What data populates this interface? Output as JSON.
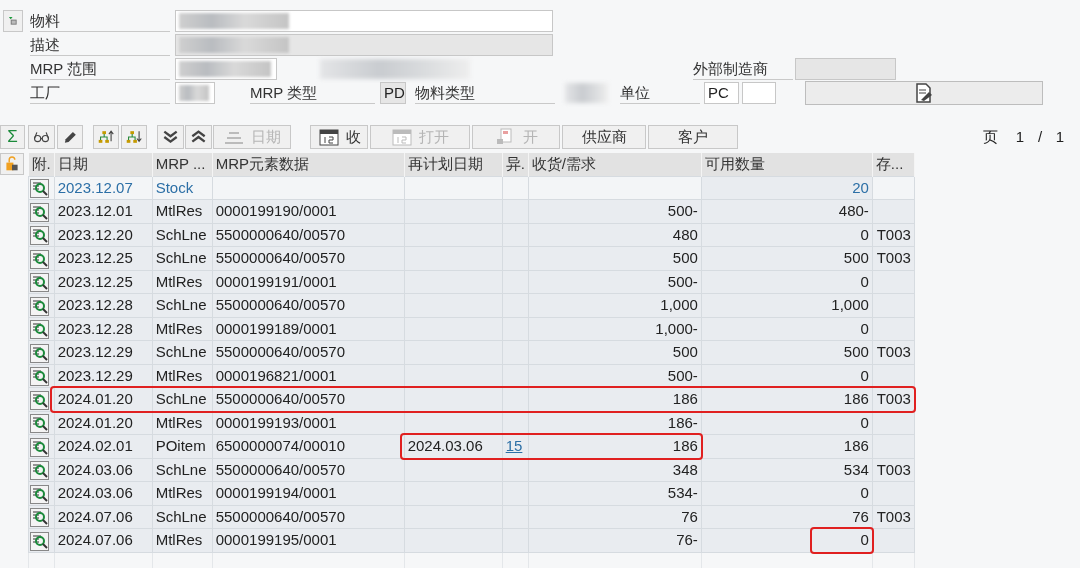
{
  "header_rows": [
    [
      {
        "kind": "filter-button"
      },
      {
        "kind": "label",
        "text": "物料"
      },
      {
        "kind": "field",
        "blurred": true,
        "readonly": false
      }
    ],
    [
      {
        "kind": "label",
        "text": "描述"
      },
      {
        "kind": "field",
        "blurred": true,
        "readonly": true
      }
    ],
    [
      {
        "kind": "label",
        "text": "MRP 范围"
      },
      {
        "kind": "field",
        "blurred": true,
        "readonly": false
      },
      {
        "kind": "blur"
      },
      {
        "kind": "label",
        "text": "外部制造商"
      },
      {
        "kind": "field",
        "readonly": true
      }
    ],
    [
      {
        "kind": "label",
        "text": "工厂"
      },
      {
        "kind": "field",
        "blurred": true,
        "readonly": false
      },
      {
        "kind": "label",
        "text": "MRP 类型"
      },
      {
        "kind": "field",
        "value": "PD",
        "readonly": true
      },
      {
        "kind": "label",
        "text": "物料类型"
      },
      {
        "kind": "blur"
      },
      {
        "kind": "label",
        "text": "单位"
      },
      {
        "kind": "field",
        "value": "PC",
        "readonly": false
      },
      {
        "kind": "field",
        "readonly": false
      },
      {
        "kind": "document-button"
      }
    ]
  ],
  "toolbar": [
    {
      "kind": "sum",
      "label": "Σ",
      "disabled": false
    },
    {
      "kind": "glasses",
      "disabled": false
    },
    {
      "kind": "pencil",
      "disabled": false
    },
    {
      "kind": "tree-up",
      "disabled": false
    },
    {
      "kind": "tree-down",
      "disabled": false
    },
    {
      "kind": "chevrons-down",
      "disabled": false
    },
    {
      "kind": "chevrons-up",
      "disabled": false
    },
    {
      "kind": "lines",
      "label": "日期",
      "disabled": true
    },
    {
      "kind": "calendar",
      "label": "收",
      "disabled": false
    },
    {
      "kind": "calendar",
      "label": "打开",
      "disabled": true
    },
    {
      "kind": "page",
      "label": "开",
      "disabled": true
    },
    {
      "kind": "none",
      "label": "供应商",
      "disabled": false
    },
    {
      "kind": "none",
      "label": "客户",
      "disabled": false
    }
  ],
  "pager": {
    "label": "页",
    "current": "1",
    "separator": "/",
    "total": "1"
  },
  "table": {
    "columns": [
      "附.",
      "日期",
      "MRP ...",
      "MRP元素数据",
      "再计划日期",
      "异.",
      "收货/需求",
      "可用数量",
      "存..."
    ],
    "rows": [
      {
        "kind": "stock",
        "date": "2023.12.07",
        "element": "Stock",
        "available": "20"
      },
      {
        "kind": "element",
        "date": "2023.12.01",
        "element": "MtlRes",
        "data": "0000199190/0001",
        "receipt": "500-",
        "available": "480-"
      },
      {
        "kind": "element",
        "date": "2023.12.20",
        "element": "SchLne",
        "data": "5500000640/00570",
        "receipt": "480",
        "available": "0",
        "storage": "T003"
      },
      {
        "kind": "element",
        "date": "2023.12.25",
        "element": "SchLne",
        "data": "5500000640/00570",
        "receipt": "500",
        "available": "500",
        "storage": "T003"
      },
      {
        "kind": "element",
        "date": "2023.12.25",
        "element": "MtlRes",
        "data": "0000199191/0001",
        "receipt": "500-",
        "available": "0"
      },
      {
        "kind": "element",
        "date": "2023.12.28",
        "element": "SchLne",
        "data": "5500000640/00570",
        "receipt": "1,000",
        "available": "1,000"
      },
      {
        "kind": "element",
        "date": "2023.12.28",
        "element": "MtlRes",
        "data": "0000199189/0001",
        "receipt": "1,000-",
        "available": "0"
      },
      {
        "kind": "element",
        "date": "2023.12.29",
        "element": "SchLne",
        "data": "5500000640/00570",
        "receipt": "500",
        "available": "500",
        "storage": "T003"
      },
      {
        "kind": "element",
        "date": "2023.12.29",
        "element": "MtlRes",
        "data": "0000196821/0001",
        "receipt": "500-",
        "available": "0"
      },
      {
        "kind": "element",
        "date": "2024.01.20",
        "element": "SchLne",
        "data": "5500000640/00570",
        "receipt": "186",
        "available": "186",
        "storage": "T003",
        "highlight": {
          "kind": "row"
        }
      },
      {
        "kind": "element",
        "date": "2024.01.20",
        "element": "MtlRes",
        "data": "0000199193/0001",
        "receipt": "186-",
        "available": "0"
      },
      {
        "kind": "element",
        "date": "2024.02.01",
        "element": "POitem",
        "data": "6500000074/00010",
        "reschedule": "2024.03.06",
        "exception": "15",
        "receipt": "186",
        "available": "186",
        "highlight": {
          "kind": "reschedule-receipt"
        }
      },
      {
        "kind": "element",
        "date": "2024.03.06",
        "element": "SchLne",
        "data": "5500000640/00570",
        "receipt": "348",
        "available": "534",
        "storage": "T003"
      },
      {
        "kind": "element",
        "date": "2024.03.06",
        "element": "MtlRes",
        "data": "0000199194/0001",
        "receipt": "534-",
        "available": "0"
      },
      {
        "kind": "element",
        "date": "2024.07.06",
        "element": "SchLne",
        "data": "5500000640/00570",
        "receipt": "76",
        "available": "76",
        "storage": "T003"
      },
      {
        "kind": "element",
        "date": "2024.07.06",
        "element": "MtlRes",
        "data": "0000199195/0001",
        "receipt": "76-",
        "available": "0",
        "highlight": {
          "kind": "available"
        }
      }
    ]
  }
}
